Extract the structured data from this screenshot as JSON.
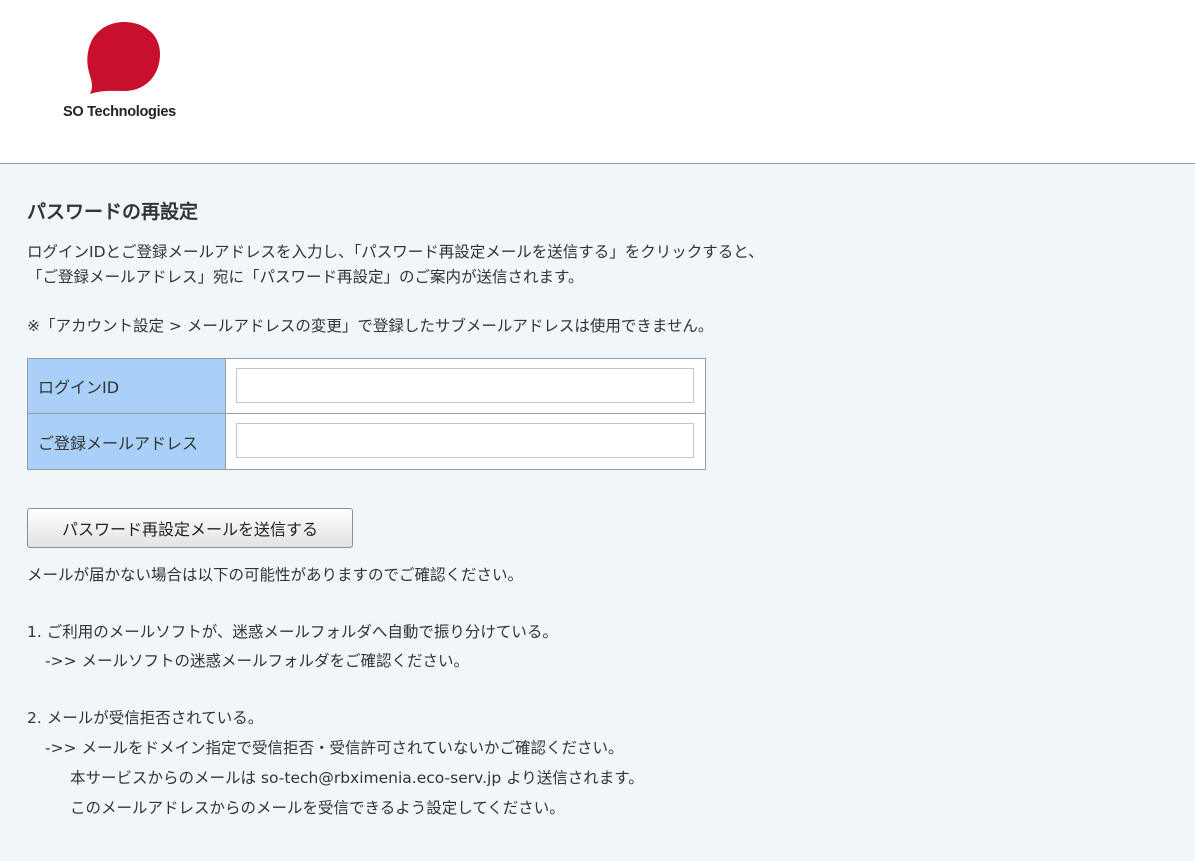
{
  "header": {
    "logo_text": "SO Technologies",
    "logo_color": "#c8102e"
  },
  "main": {
    "title": "パスワードの再設定",
    "description_line1": "ログインIDとご登録メールアドレスを入力し、「パスワード再設定メールを送信する」をクリックすると、",
    "description_line2": "「ご登録メールアドレス」宛に「パスワード再設定」のご案内が送信されます。",
    "note": "※「アカウント設定 > メールアドレスの変更」で登録したサブメールアドレスは使用できません。",
    "form": {
      "login_id_label": "ログインID",
      "login_id_value": "",
      "email_label": "ご登録メールアドレス",
      "email_value": ""
    },
    "submit_label": "パスワード再設定メールを送信する",
    "help": {
      "intro": "メールが届かない場合は以下の可能性がありますのでご確認ください。",
      "item1": "1. ご利用のメールソフトが、迷惑メールフォルダへ自動で振り分けている。",
      "item1_sub": "->> メールソフトの迷惑メールフォルダをご確認ください。",
      "item2": "2. メールが受信拒否されている。",
      "item2_sub": "->> メールをドメイン指定で受信拒否・受信許可されていないかご確認ください。",
      "item2_detail1": "本サービスからのメールは so-tech@rbximenia.eco-serv.jp より送信されます。",
      "item2_detail2": "このメールアドレスからのメールを受信できるよう設定してください。"
    }
  }
}
